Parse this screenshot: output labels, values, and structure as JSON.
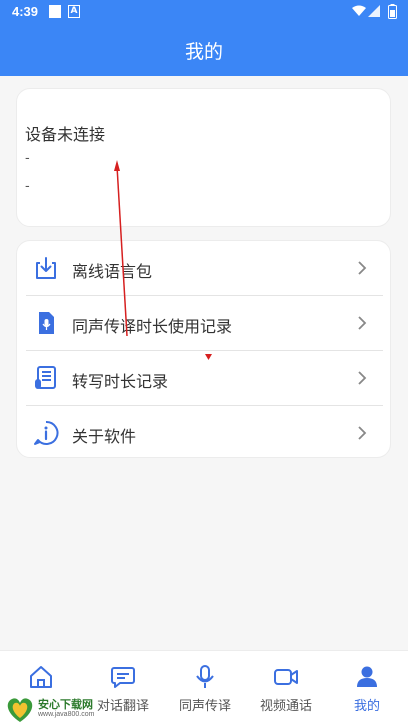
{
  "status_bar": {
    "time": "4:39",
    "notification_badge": "A"
  },
  "header": {
    "title": "我的"
  },
  "device": {
    "status": "设备未连接",
    "line1": "-",
    "line2": "-"
  },
  "menu": {
    "items": [
      {
        "label": "离线语言包",
        "icon": "download-icon"
      },
      {
        "label": "同声传译时长使用记录",
        "icon": "document-mic-icon"
      },
      {
        "label": "转写时长记录",
        "icon": "transcript-icon"
      },
      {
        "label": "关于软件",
        "icon": "info-icon"
      }
    ]
  },
  "bottom_nav": {
    "tabs": [
      {
        "label": "",
        "icon": "home-icon"
      },
      {
        "label": "对话翻译",
        "icon": "chat-icon"
      },
      {
        "label": "同声传译",
        "icon": "microphone-icon"
      },
      {
        "label": "视频通话",
        "icon": "video-icon"
      },
      {
        "label": "我的",
        "icon": "profile-icon"
      }
    ],
    "active_index": 4
  },
  "watermark": {
    "text": "安心下载网",
    "sub": "www.java800.com"
  },
  "colors": {
    "primary": "#3b86f6",
    "accent_icon": "#3b6fe0",
    "annotation": "#d62020"
  }
}
